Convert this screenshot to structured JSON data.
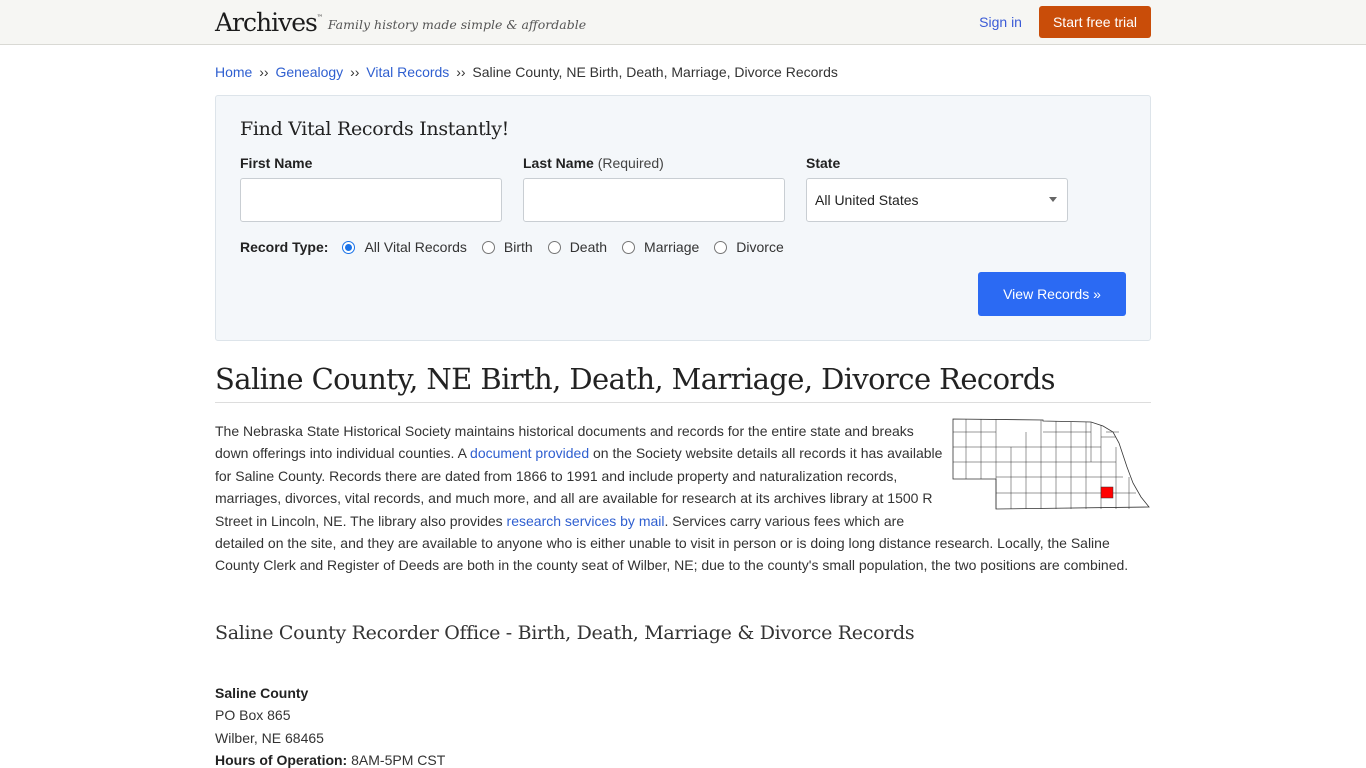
{
  "header": {
    "logo": "Archives",
    "logo_tm": "™",
    "tagline": "Family history made simple & affordable",
    "sign_in": "Sign in",
    "trial_button": "Start free trial"
  },
  "breadcrumb": {
    "items": [
      "Home",
      "Genealogy",
      "Vital Records"
    ],
    "separator": "››",
    "current": "Saline County, NE Birth, Death, Marriage, Divorce Records"
  },
  "search": {
    "title": "Find Vital Records Instantly!",
    "first_name_label": "First Name",
    "first_name_value": "",
    "last_name_label": "Last Name",
    "last_name_required": "(Required)",
    "last_name_value": "",
    "state_label": "State",
    "state_selected": "All United States",
    "record_type_label": "Record Type:",
    "record_types": [
      {
        "label": "All Vital Records",
        "checked": true
      },
      {
        "label": "Birth",
        "checked": false
      },
      {
        "label": "Death",
        "checked": false
      },
      {
        "label": "Marriage",
        "checked": false
      },
      {
        "label": "Divorce",
        "checked": false
      }
    ],
    "submit_label": "View Records »"
  },
  "page": {
    "title": "Saline County, NE Birth, Death, Marriage, Divorce Records",
    "intro": {
      "p1": "The Nebraska State Historical Society maintains historical documents and records for the entire state and breaks down offerings into individual counties. A ",
      "link1": "document provided",
      "p2": " on the Society website details all records it has available for Saline County. Records there are dated from 1866 to 1991 and include property and naturalization records, marriages, divorces, vital records, and much more, and all are available for research at its archives library at 1500 R Street in Lincoln, NE. The library also provides ",
      "link2": "research services by mail",
      "p3": ". Services carry various fees which are detailed on the site, and they are available to anyone who is either unable to visit in person or is doing long distance research. Locally, the Saline County Clerk and Register of Deeds are both in the county seat of Wilber, NE; due to the county's small population, the two positions are combined."
    },
    "map_alt": "Nebraska county map with Saline County highlighted",
    "map_highlight_color": "#ff0000",
    "section_title": "Saline County Recorder Office - Birth, Death, Marriage & Divorce Records",
    "office": {
      "name": "Saline County",
      "address1": "PO Box 865",
      "address2": "Wilber, NE 68465",
      "hours_label": "Hours of Operation:",
      "hours_value": "8AM-5PM CST"
    }
  },
  "colors": {
    "trial_button": "#c94d09",
    "view_button": "#2b6af3",
    "link": "#2f5fd0"
  }
}
